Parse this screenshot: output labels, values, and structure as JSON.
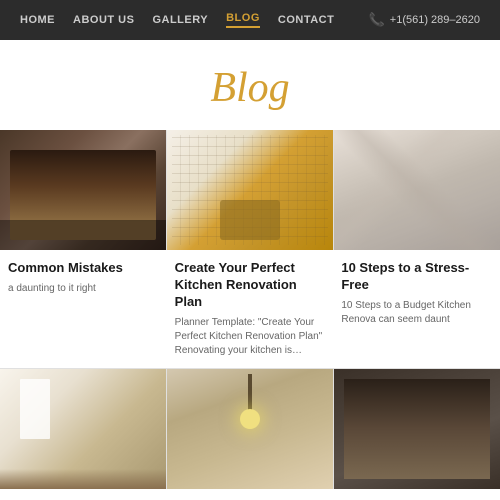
{
  "header": {
    "nav_items": [
      {
        "label": "HOME",
        "active": false
      },
      {
        "label": "ABOUT US",
        "active": false
      },
      {
        "label": "GALLERY",
        "active": false
      },
      {
        "label": "BLOG",
        "active": true
      },
      {
        "label": "CONTACT",
        "active": false
      }
    ],
    "phone": "+1(561) 289–2620"
  },
  "page": {
    "title": "Blog"
  },
  "blog_row1": {
    "cards": [
      {
        "title": "Common Mistakes",
        "excerpt": "a daunting to it right",
        "img_class": "img-kitchen-dark"
      },
      {
        "title": "Create Your Perfect Kitchen Renovation Plan",
        "excerpt": "Planner Template: \"Create Your Perfect Kitchen Renovation Plan\" Renovating your kitchen is…",
        "img_class": "img-sketch"
      },
      {
        "title": "10 Steps to a Stress-Free",
        "excerpt": "10 Steps to a Budget Kitchen Renova can seem daunt",
        "img_class": "img-marble"
      }
    ]
  },
  "blog_row2": {
    "cards": [
      {
        "img_class": "img-bright-kitchen"
      },
      {
        "img_class": "img-pendant"
      },
      {
        "img_class": "img-dark-modern"
      }
    ]
  }
}
